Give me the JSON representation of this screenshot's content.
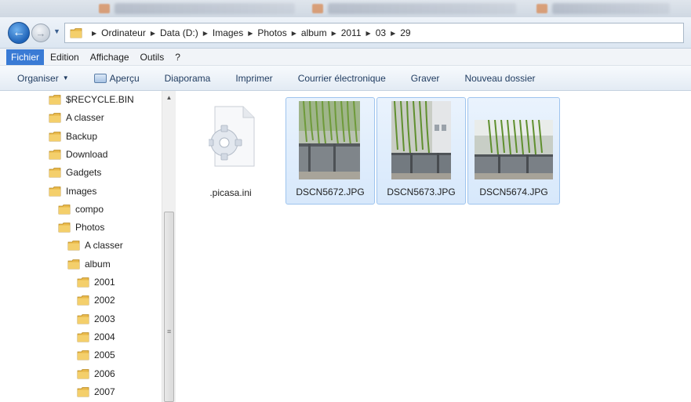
{
  "address": {
    "crumbs": [
      "Ordinateur",
      "Data (D:)",
      "Images",
      "Photos",
      "album",
      "2011",
      "03",
      "29"
    ]
  },
  "menu": {
    "items": [
      "Fichier",
      "Edition",
      "Affichage",
      "Outils",
      "?"
    ]
  },
  "toolbar": {
    "organize": "Organiser",
    "preview": "Aperçu",
    "slideshow": "Diaporama",
    "print": "Imprimer",
    "email": "Courrier électronique",
    "burn": "Graver",
    "new_folder": "Nouveau dossier"
  },
  "nav_tree": [
    {
      "label": "$RECYCLE.BIN",
      "level": 0
    },
    {
      "label": "A classer",
      "level": 0
    },
    {
      "label": "Backup",
      "level": 0
    },
    {
      "label": "Download",
      "level": 0
    },
    {
      "label": "Gadgets",
      "level": 0
    },
    {
      "label": "Images",
      "level": 0
    },
    {
      "label": "compo",
      "level": 1
    },
    {
      "label": "Photos",
      "level": 1
    },
    {
      "label": "A classer",
      "level": 2
    },
    {
      "label": "album",
      "level": 2
    },
    {
      "label": "2001",
      "level": 3
    },
    {
      "label": "2002",
      "level": 3
    },
    {
      "label": "2003",
      "level": 3
    },
    {
      "label": "2004",
      "level": 3
    },
    {
      "label": "2005",
      "level": 3
    },
    {
      "label": "2006",
      "level": 3
    },
    {
      "label": "2007",
      "level": 3
    }
  ],
  "files": [
    {
      "name": ".picasa.ini",
      "type": "settings",
      "selected": false
    },
    {
      "name": "DSCN5672.JPG",
      "type": "photo",
      "selected": true
    },
    {
      "name": "DSCN5673.JPG",
      "type": "photo",
      "selected": true
    },
    {
      "name": "DSCN5674.JPG",
      "type": "photo",
      "selected": true
    }
  ],
  "colors": {
    "selection_bg": "#d7e8fb",
    "selection_border": "#9ec4ee",
    "menu_active": "#3a7bd5",
    "folder": "#e8b84a"
  }
}
